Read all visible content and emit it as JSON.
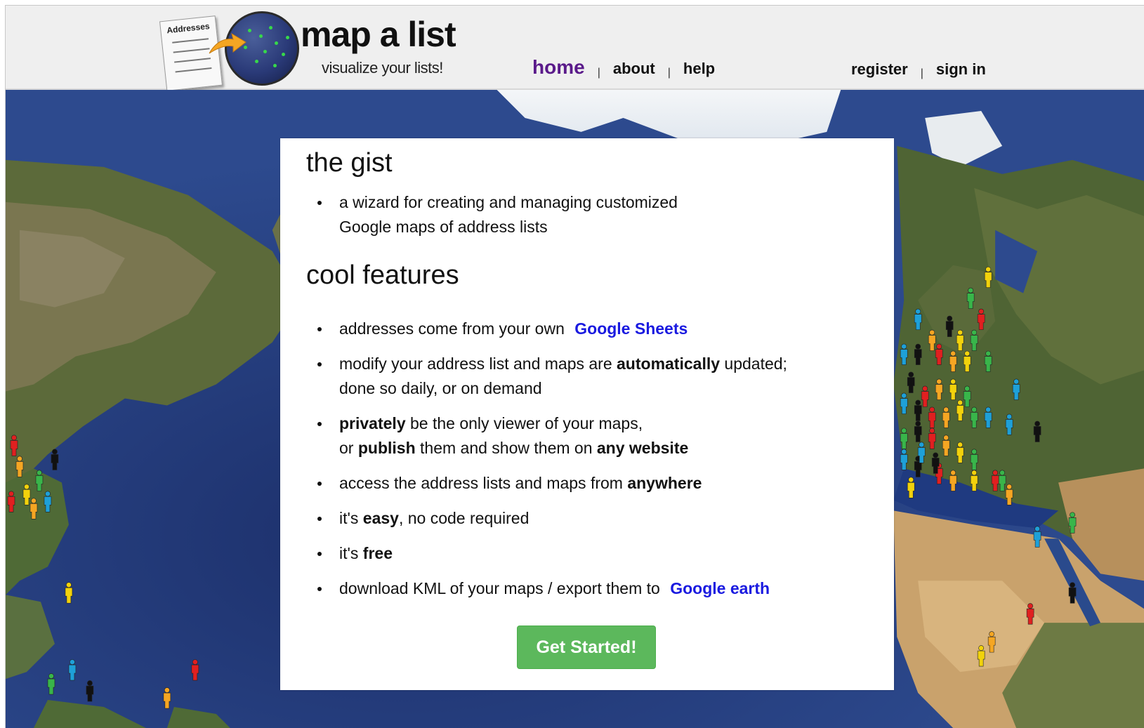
{
  "header": {
    "logo": {
      "title": "map a list",
      "tagline": "visualize your lists!",
      "notepad_label": "Addresses"
    },
    "nav": {
      "home": "home",
      "about": "about",
      "help": "help",
      "separator": "|"
    },
    "auth": {
      "register": "register",
      "sign_in": "sign in",
      "separator": "|"
    }
  },
  "card": {
    "gist_heading": "the gist",
    "gist_items": [
      "a wizard for creating and managing customized Google maps of address lists"
    ],
    "features_heading": "cool features",
    "features": {
      "f1_text": "addresses come from your own",
      "f1_link": "Google Sheets",
      "f2_a": "modify your address list and maps are",
      "f2_bold": "automatically",
      "f2_b": "updated;",
      "f2_c": "done so daily, or on demand",
      "f3_bold1": "privately",
      "f3_a": "be the only viewer of your maps,",
      "f3_b": "or",
      "f3_bold2": "publish",
      "f3_c": "them and show them on",
      "f3_bold3": "any website",
      "f4_a": "access the address lists and maps from",
      "f4_bold": "anywhere",
      "f5_a": "it's",
      "f5_bold": "easy",
      "f5_b": ", no code required",
      "f6_a": "it's",
      "f6_bold": "free",
      "f7_a": "download KML of your maps / export them to",
      "f7_link": "Google earth"
    },
    "cta": "Get Started!"
  },
  "colors": {
    "nav_active": "#5a1a8a",
    "link": "#1a1ae0",
    "cta_bg": "#5cb85c",
    "header_bg": "#efefef",
    "ocean": "#233a7a"
  },
  "icons": [
    "notepad-icon",
    "globe-icon",
    "arrow-icon",
    "map-pin-person-icon"
  ]
}
